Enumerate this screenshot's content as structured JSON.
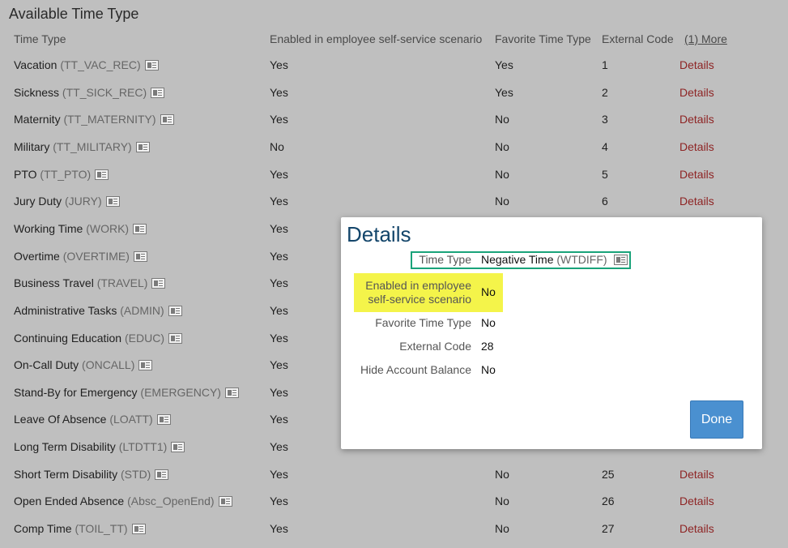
{
  "page_title": "Available Time Type",
  "headers": {
    "time_type": "Time Type",
    "enabled": "Enabled in employee self-service scenario",
    "favorite": "Favorite Time Type",
    "external_code": "External Code",
    "more": "(1) More"
  },
  "rows": [
    {
      "name": "Vacation",
      "code": "(TT_VAC_REC)",
      "enabled": "Yes",
      "favorite": "Yes",
      "ext": "1",
      "link": "Details"
    },
    {
      "name": "Sickness",
      "code": "(TT_SICK_REC)",
      "enabled": "Yes",
      "favorite": "Yes",
      "ext": "2",
      "link": "Details"
    },
    {
      "name": "Maternity",
      "code": "(TT_MATERNITY)",
      "enabled": "Yes",
      "favorite": "No",
      "ext": "3",
      "link": "Details"
    },
    {
      "name": "Military",
      "code": "(TT_MILITARY)",
      "enabled": "No",
      "favorite": "No",
      "ext": "4",
      "link": "Details"
    },
    {
      "name": "PTO",
      "code": "(TT_PTO)",
      "enabled": "Yes",
      "favorite": "No",
      "ext": "5",
      "link": "Details"
    },
    {
      "name": "Jury Duty",
      "code": "(JURY)",
      "enabled": "Yes",
      "favorite": "No",
      "ext": "6",
      "link": "Details"
    },
    {
      "name": "Working Time",
      "code": "(WORK)",
      "enabled": "Yes",
      "favorite": "",
      "ext": "",
      "link": ""
    },
    {
      "name": "Overtime",
      "code": "(OVERTIME)",
      "enabled": "Yes",
      "favorite": "",
      "ext": "",
      "link": ""
    },
    {
      "name": "Business Travel",
      "code": "(TRAVEL)",
      "enabled": "Yes",
      "favorite": "",
      "ext": "",
      "link": ""
    },
    {
      "name": "Administrative Tasks",
      "code": "(ADMIN)",
      "enabled": "Yes",
      "favorite": "",
      "ext": "",
      "link": ""
    },
    {
      "name": "Continuing Education",
      "code": "(EDUC)",
      "enabled": "Yes",
      "favorite": "",
      "ext": "",
      "link": ""
    },
    {
      "name": "On-Call Duty",
      "code": "(ONCALL)",
      "enabled": "Yes",
      "favorite": "",
      "ext": "",
      "link": ""
    },
    {
      "name": "Stand-By for Emergency",
      "code": "(EMERGENCY)",
      "enabled": "Yes",
      "favorite": "",
      "ext": "",
      "link": ""
    },
    {
      "name": "Leave Of Absence",
      "code": "(LOATT)",
      "enabled": "Yes",
      "favorite": "",
      "ext": "",
      "link": ""
    },
    {
      "name": "Long Term Disability",
      "code": "(LTDTT1)",
      "enabled": "Yes",
      "favorite": "",
      "ext": "",
      "link": ""
    },
    {
      "name": "Short Term Disability",
      "code": "(STD)",
      "enabled": "Yes",
      "favorite": "No",
      "ext": "25",
      "link": "Details"
    },
    {
      "name": "Open Ended Absence",
      "code": "(Absc_OpenEnd)",
      "enabled": "Yes",
      "favorite": "No",
      "ext": "26",
      "link": "Details"
    },
    {
      "name": "Comp Time",
      "code": "(TOIL_TT)",
      "enabled": "Yes",
      "favorite": "No",
      "ext": "27",
      "link": "Details"
    }
  ],
  "dialog": {
    "title": "Details",
    "time_type_label": "Time Type",
    "time_type_name": "Negative Time",
    "time_type_code": "(WTDIFF)",
    "enabled_label_1": "Enabled in employee",
    "enabled_label_2": "self-service scenario",
    "enabled_value": "No",
    "favorite_label": "Favorite Time Type",
    "favorite_value": "No",
    "ext_label": "External Code",
    "ext_value": "28",
    "hide_label": "Hide Account Balance",
    "hide_value": "No",
    "done": "Done"
  },
  "colors": {
    "background": "#bfbfbf",
    "link": "#8e2424",
    "dialog_title": "#14466b",
    "button": "#4a90d0",
    "highlight_green": "#1aa37a",
    "highlight_yellow": "#f4f44a"
  }
}
